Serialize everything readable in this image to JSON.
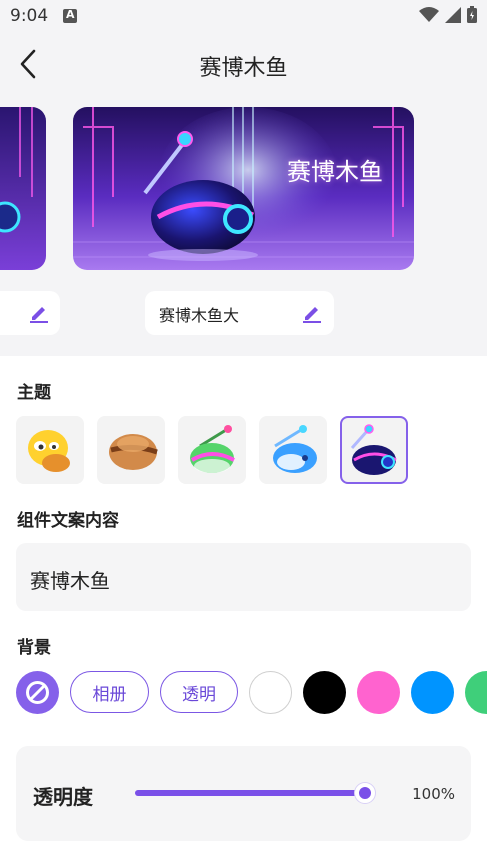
{
  "status_bar": {
    "time": "9:04"
  },
  "header": {
    "title": "赛博木鱼"
  },
  "preview": {
    "card_label": "赛博木鱼",
    "name_value": "赛博木鱼大"
  },
  "theme": {
    "title": "主题",
    "items": [
      {
        "icon": "emoji-fish-icon",
        "selected": false
      },
      {
        "icon": "wooden-fish-icon",
        "selected": false
      },
      {
        "icon": "green-fish-icon",
        "selected": false
      },
      {
        "icon": "blue-fish-icon",
        "selected": false
      },
      {
        "icon": "cyber-fish-icon",
        "selected": true
      }
    ]
  },
  "content": {
    "title": "组件文案内容",
    "value": "赛博木鱼"
  },
  "background": {
    "title": "背景",
    "album_label": "相册",
    "transparent_label": "透明",
    "colors": [
      "#ffffff",
      "#000000",
      "#ff63cf",
      "#0094ff",
      "#3fcf7a"
    ],
    "accent": "#8561ea"
  },
  "opacity": {
    "label": "透明度",
    "value": 1.0,
    "value_text": "100%"
  }
}
